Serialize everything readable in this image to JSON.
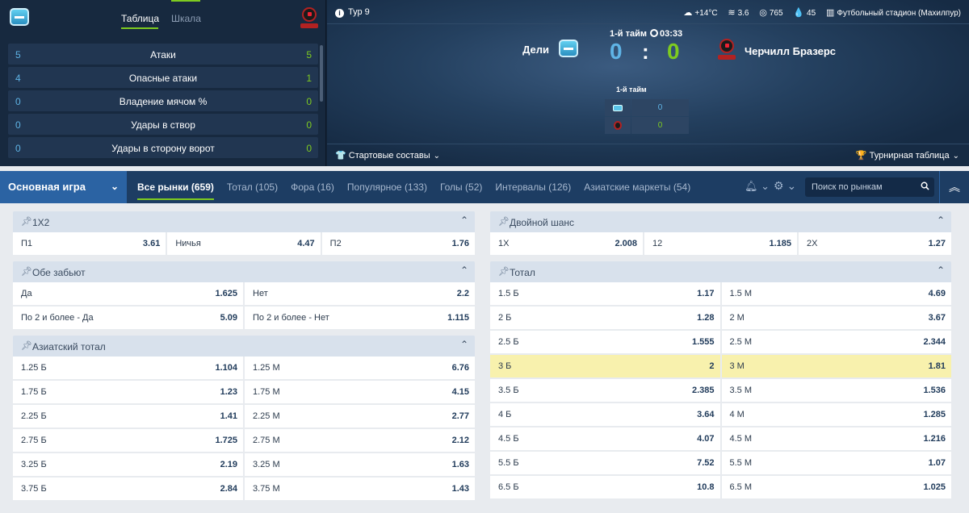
{
  "stats_panel": {
    "tabs": [
      "Таблица",
      "Шкала"
    ],
    "rows": [
      {
        "left": "5",
        "label": "Атаки",
        "right": "5"
      },
      {
        "left": "4",
        "label": "Опасные атаки",
        "right": "1"
      },
      {
        "left": "0",
        "label": "Владение мячом %",
        "right": "0"
      },
      {
        "left": "0",
        "label": "Удары в створ",
        "right": "0"
      },
      {
        "left": "0",
        "label": "Удары в сторону ворот",
        "right": "0"
      }
    ]
  },
  "match": {
    "round": "Тур 9",
    "temperature": "+14°C",
    "wind": "3.6",
    "pressure": "765",
    "humidity": "45",
    "venue": "Футбольный стадион (Махилпур)",
    "team1": "Дели",
    "team2": "Черчилл Бразерс",
    "period": "1-й тайм",
    "time": "03:33",
    "score1": "0",
    "score2": "0",
    "half_label": "1-й тайм",
    "half_score1": "0",
    "half_score2": "0",
    "lineups": "Стартовые составы",
    "standings": "Турнирная таблица"
  },
  "nav": {
    "game_select": "Основная игра",
    "tabs": [
      "Все рынки (659)",
      "Тотал (105)",
      "Фора (16)",
      "Популярное (133)",
      "Голы (52)",
      "Интервалы (126)",
      "Азиатские маркеты (54)"
    ],
    "search_placeholder": "Поиск по рынкам"
  },
  "markets": {
    "m1x2": {
      "title": "1X2",
      "cells": [
        [
          "П1",
          "3.61"
        ],
        [
          "Ничья",
          "4.47"
        ],
        [
          "П2",
          "1.76"
        ]
      ]
    },
    "both": {
      "title": "Обе забьют",
      "cells": [
        [
          "Да",
          "1.625"
        ],
        [
          "Нет",
          "2.2"
        ],
        [
          "По 2 и более - Да",
          "5.09"
        ],
        [
          "По 2 и более - Нет",
          "1.115"
        ]
      ]
    },
    "asian": {
      "title": "Азиатский тотал",
      "cells": [
        [
          "1.25 Б",
          "1.104"
        ],
        [
          "1.25 М",
          "6.76"
        ],
        [
          "1.75 Б",
          "1.23"
        ],
        [
          "1.75 М",
          "4.15"
        ],
        [
          "2.25 Б",
          "1.41"
        ],
        [
          "2.25 М",
          "2.77"
        ],
        [
          "2.75 Б",
          "1.725"
        ],
        [
          "2.75 М",
          "2.12"
        ],
        [
          "3.25 Б",
          "2.19"
        ],
        [
          "3.25 М",
          "1.63"
        ],
        [
          "3.75 Б",
          "2.84"
        ],
        [
          "3.75 М",
          "1.43"
        ]
      ]
    },
    "double": {
      "title": "Двойной шанс",
      "cells": [
        [
          "1X",
          "2.008"
        ],
        [
          "12",
          "1.185"
        ],
        [
          "2X",
          "1.27"
        ]
      ]
    },
    "total": {
      "title": "Тотал",
      "cells": [
        [
          "1.5 Б",
          "1.17"
        ],
        [
          "1.5 М",
          "4.69"
        ],
        [
          "2 Б",
          "1.28"
        ],
        [
          "2 М",
          "3.67"
        ],
        [
          "2.5 Б",
          "1.555"
        ],
        [
          "2.5 М",
          "2.344"
        ],
        [
          "3 Б",
          "2"
        ],
        [
          "3 М",
          "1.81"
        ],
        [
          "3.5 Б",
          "2.385"
        ],
        [
          "3.5 М",
          "1.536"
        ],
        [
          "4 Б",
          "3.64"
        ],
        [
          "4 М",
          "1.285"
        ],
        [
          "4.5 Б",
          "4.07"
        ],
        [
          "4.5 М",
          "1.216"
        ],
        [
          "5.5 Б",
          "7.52"
        ],
        [
          "5.5 М",
          "1.07"
        ],
        [
          "6.5 Б",
          "10.8"
        ],
        [
          "6.5 М",
          "1.025"
        ]
      ]
    }
  }
}
